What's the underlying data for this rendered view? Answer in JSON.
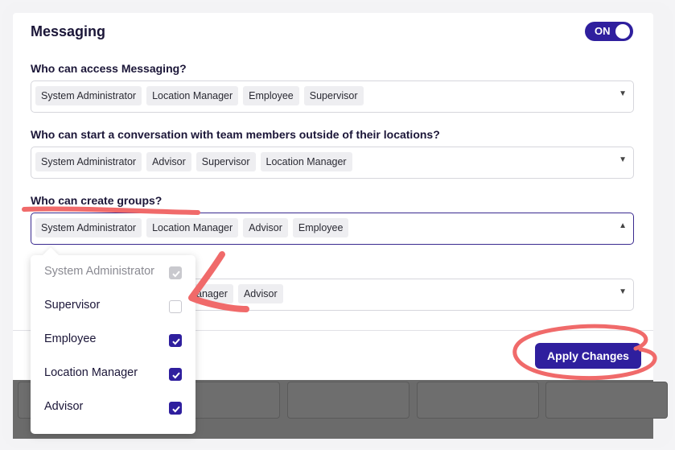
{
  "section": {
    "title": "Messaging",
    "toggle_label": "ON"
  },
  "questions": [
    {
      "label": "Who can access Messaging?",
      "chips": [
        "System Administrator",
        "Location Manager",
        "Employee",
        "Supervisor"
      ]
    },
    {
      "label": "Who can start a conversation with team members outside of their locations?",
      "chips": [
        "System Administrator",
        "Advisor",
        "Supervisor",
        "Location Manager"
      ]
    },
    {
      "label": "Who can create groups?",
      "chips": [
        "System Administrator",
        "Location Manager",
        "Advisor",
        "Employee"
      ]
    },
    {
      "label": "",
      "chips": [
        "anager",
        "Advisor"
      ]
    }
  ],
  "dropdown": {
    "options": [
      {
        "label": "System Administrator",
        "state": "disabled"
      },
      {
        "label": "Supervisor",
        "state": "unchecked"
      },
      {
        "label": "Employee",
        "state": "checked"
      },
      {
        "label": "Location Manager",
        "state": "checked"
      },
      {
        "label": "Advisor",
        "state": "checked"
      }
    ]
  },
  "footer": {
    "apply_label": "Apply Changes"
  },
  "colors": {
    "accent": "#2f1f9e",
    "annotation": "#f06a6a"
  },
  "icons": {
    "caret_down": "caret-down-icon",
    "caret_up": "caret-up-icon",
    "check": "check-icon"
  }
}
